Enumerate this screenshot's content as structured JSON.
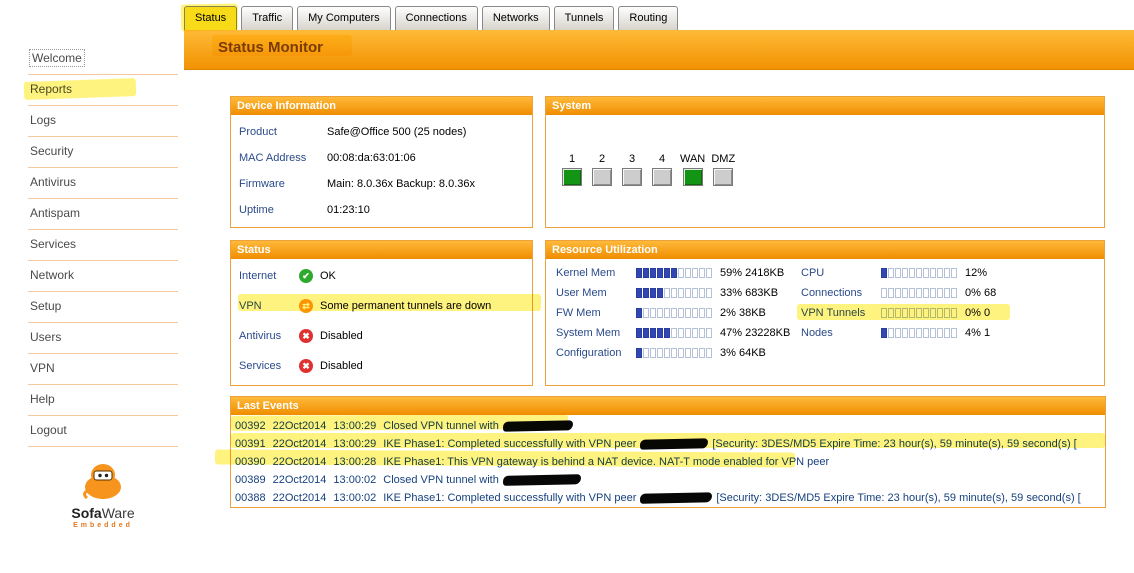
{
  "page_title": "Status Monitor",
  "tabs": [
    {
      "label": "Status",
      "active": true
    },
    {
      "label": "Traffic",
      "active": false
    },
    {
      "label": "My Computers",
      "active": false
    },
    {
      "label": "Connections",
      "active": false
    },
    {
      "label": "Networks",
      "active": false
    },
    {
      "label": "Tunnels",
      "active": false
    },
    {
      "label": "Routing",
      "active": false
    }
  ],
  "sidebar": {
    "items": [
      "Welcome",
      "Reports",
      "Logs",
      "Security",
      "Antivirus",
      "Antispam",
      "Services",
      "Network",
      "Setup",
      "Users",
      "VPN",
      "Help",
      "Logout"
    ],
    "logo": {
      "brand_bold": "Sofa",
      "brand_rest": "Ware",
      "sub": "Embedded"
    }
  },
  "device_information": {
    "title": "Device Information",
    "rows": [
      {
        "label": "Product",
        "value": "Safe@Office 500 (25 nodes)"
      },
      {
        "label": "MAC Address",
        "value": "00:08:da:63:01:06"
      },
      {
        "label": "Firmware",
        "value": "Main: 8.0.36x Backup: 8.0.36x"
      },
      {
        "label": "Uptime",
        "value": "01:23:10"
      }
    ]
  },
  "system": {
    "title": "System",
    "ports": [
      {
        "label": "1",
        "on": true
      },
      {
        "label": "2",
        "on": false
      },
      {
        "label": "3",
        "on": false
      },
      {
        "label": "4",
        "on": false
      },
      {
        "label": "WAN",
        "on": true
      },
      {
        "label": "DMZ",
        "on": false
      }
    ]
  },
  "status_panel": {
    "title": "Status",
    "rows": [
      {
        "label": "Internet",
        "icon": "ok",
        "text": "OK"
      },
      {
        "label": "VPN",
        "icon": "warn",
        "text": "Some permanent tunnels are down"
      },
      {
        "label": "Antivirus",
        "icon": "error",
        "text": "Disabled"
      },
      {
        "label": "Services",
        "icon": "error",
        "text": "Disabled"
      }
    ]
  },
  "resource_utilization": {
    "title": "Resource Utilization",
    "left": [
      {
        "label": "Kernel Mem",
        "percent": 59,
        "value": "2418KB"
      },
      {
        "label": "User Mem",
        "percent": 33,
        "value": "683KB"
      },
      {
        "label": "FW Mem",
        "percent": 2,
        "value": "38KB"
      },
      {
        "label": "System Mem",
        "percent": 47,
        "value": "23228KB"
      },
      {
        "label": "Configuration",
        "percent": 3,
        "value": "64KB"
      }
    ],
    "right": [
      {
        "label": "CPU",
        "percent": 12,
        "value": ""
      },
      {
        "label": "Connections",
        "percent": 0,
        "value": "68"
      },
      {
        "label": "VPN Tunnels",
        "percent": 0,
        "value": "0"
      },
      {
        "label": "Nodes",
        "percent": 4,
        "value": "1"
      }
    ]
  },
  "last_events": {
    "title": "Last Events",
    "rows": [
      {
        "id": "00392",
        "date": "22Oct2014",
        "time": "13:00:29",
        "pre": "Closed VPN tunnel with",
        "redact_w": 70,
        "post": ""
      },
      {
        "id": "00391",
        "date": "22Oct2014",
        "time": "13:00:29",
        "pre": "IKE Phase1: Completed successfully with VPN peer",
        "redact_w": 68,
        "post": "[Security: 3DES/MD5 Expire Time: 23 hour(s), 59 minute(s), 59 second(s) ["
      },
      {
        "id": "00390",
        "date": "22Oct2014",
        "time": "13:00:28",
        "pre": "IKE Phase1: This VPN gateway is behind a NAT device. NAT-T mode enabled for VPN peer",
        "redact_w": 0,
        "post": ""
      },
      {
        "id": "00389",
        "date": "22Oct2014",
        "time": "13:00:02",
        "pre": "Closed VPN tunnel with",
        "redact_w": 78,
        "post": ""
      },
      {
        "id": "00388",
        "date": "22Oct2014",
        "time": "13:00:02",
        "pre": "IKE Phase1: Completed successfully with VPN peer",
        "redact_w": 72,
        "post": "[Security: 3DES/MD5 Expire Time: 23 hour(s), 59 minute(s), 59 second(s) ["
      }
    ]
  },
  "colors": {
    "accent_orange": "#f19202",
    "highlight_yellow": "#ffe800",
    "ok_green": "#2daa2d",
    "warn_amber": "#ff9900",
    "error_red": "#e03030",
    "meter_blue": "#3246b4",
    "port_on_green": "#149414"
  }
}
